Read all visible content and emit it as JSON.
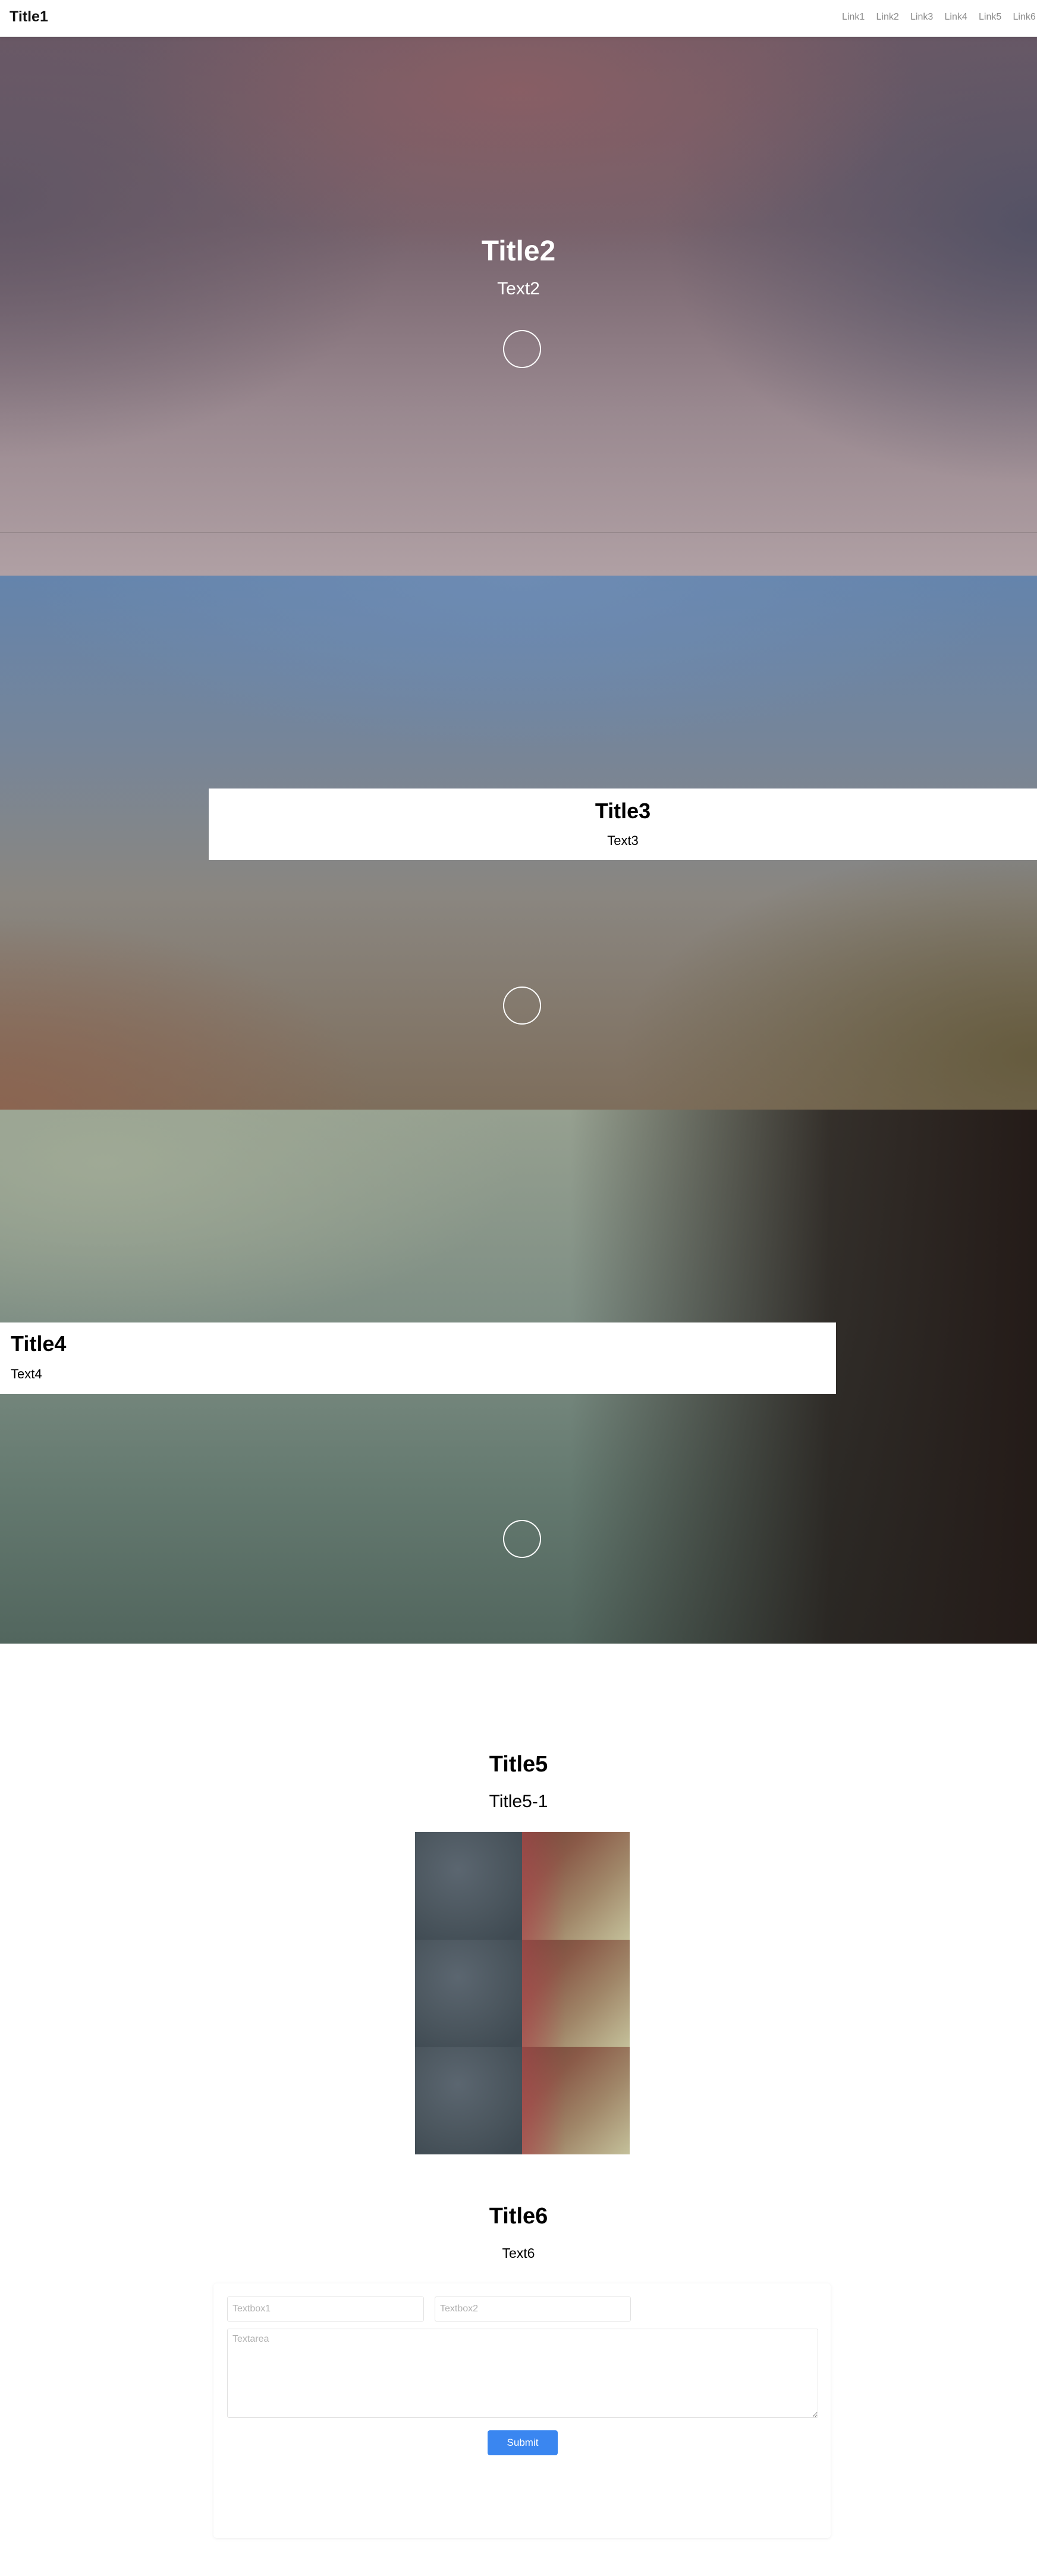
{
  "navbar": {
    "brand": "Title1",
    "links": [
      "Link1",
      "Link2",
      "Link3",
      "Link4",
      "Link5",
      "Link6"
    ]
  },
  "hero": {
    "title": "Title2",
    "text": "Text2"
  },
  "section3": {
    "title": "Title3",
    "text": "Text3"
  },
  "section4": {
    "title": "Title4",
    "text": "Text4"
  },
  "section5": {
    "title": "Title5",
    "subtitle": "Title5-1"
  },
  "section6": {
    "title": "Title6",
    "text": "Text6",
    "form": {
      "textbox1_placeholder": "Textbox1",
      "textbox2_placeholder": "Textbox2",
      "textarea_placeholder": "Textarea",
      "submit_label": "Submit"
    }
  },
  "colors": {
    "accent": "#3a86f0"
  }
}
